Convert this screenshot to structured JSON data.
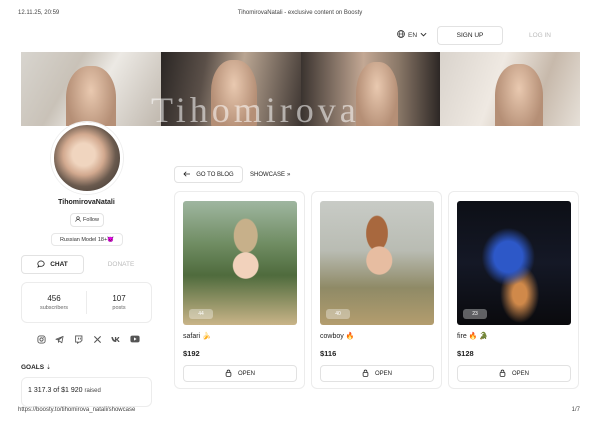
{
  "print_header": {
    "date": "12.11.25, 20:59",
    "title": "TihomirovaNatali - exclusive content on Boosty"
  },
  "nav": {
    "language": "EN",
    "signup": "SIGN UP",
    "login": "LOG IN"
  },
  "cover": {
    "text": "Tihomirova"
  },
  "profile": {
    "name": "TihomirovaNatali",
    "follow": "Follow",
    "tagline": "Russian Model 18+😈",
    "chat": "CHAT",
    "donate": "DONATE",
    "stats": [
      {
        "value": "456",
        "label": "subscribers"
      },
      {
        "value": "107",
        "label": "posts"
      }
    ],
    "socials": [
      "instagram-icon",
      "telegram-icon",
      "twitch-icon",
      "x-icon",
      "vk-icon",
      "youtube-icon"
    ]
  },
  "goals": {
    "heading": "GOALS",
    "amount": "1 317.3 of $1 920",
    "suffix": "raised"
  },
  "blog": {
    "goto": "GO TO BLOG",
    "showcase": "SHOWCASE"
  },
  "posts": [
    {
      "title": "safari 🍌",
      "price": "$192",
      "badge": "44",
      "open": "OPEN"
    },
    {
      "title": "cowboy 🔥",
      "price": "$116",
      "badge": "40",
      "open": "OPEN"
    },
    {
      "title": "fire 🔥 🐊",
      "price": "$128",
      "badge": "23",
      "open": "OPEN"
    }
  ],
  "footer": {
    "url": "https://boosty.to/tihomirova_natali/showcase",
    "page": "1/7"
  },
  "colors": {
    "text": "#222222",
    "muted": "#bbbbbb",
    "border": "#e2e2e2"
  }
}
